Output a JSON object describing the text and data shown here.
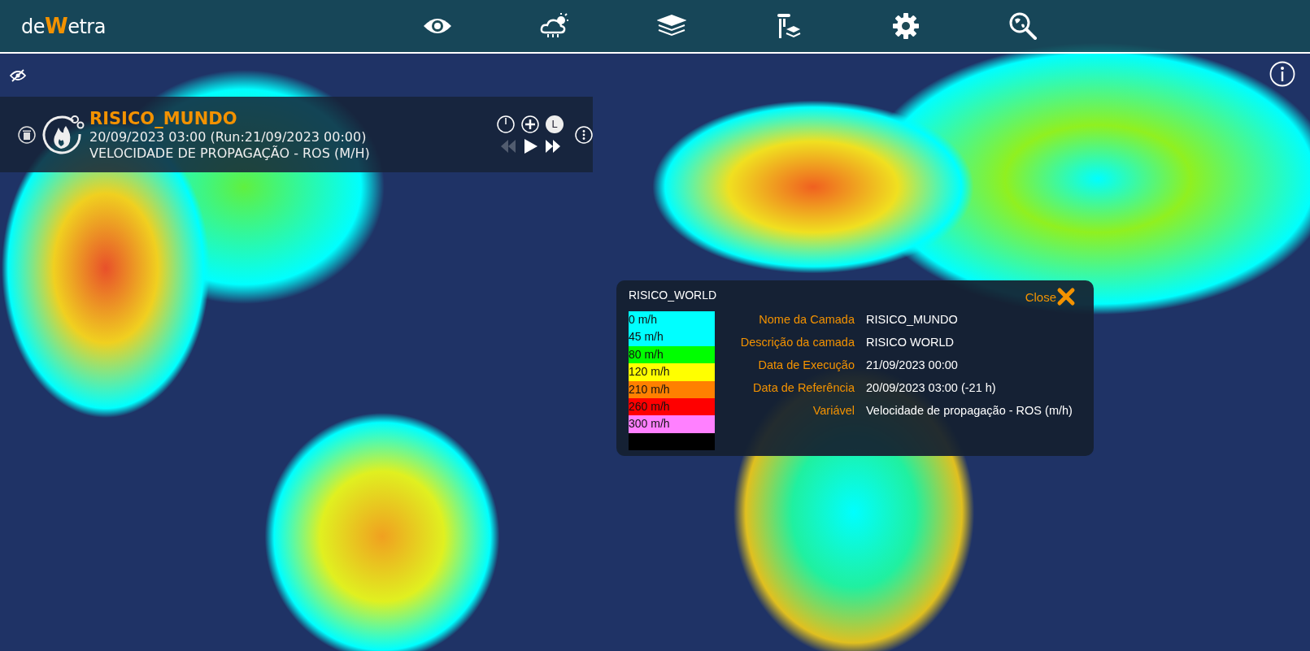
{
  "logo": {
    "before": "de",
    "mark": "W",
    "after": "etra"
  },
  "toolbar": [
    {
      "kind": "eye"
    },
    {
      "kind": "cloud"
    },
    {
      "kind": "layers"
    },
    {
      "kind": "column"
    },
    {
      "kind": "gear"
    },
    {
      "kind": "globe-search"
    }
  ],
  "layer": {
    "title": "RISICO_MUNDO",
    "date": "20/09/2023 03:00 (Run:21/09/2023 00:00)",
    "variable": "VELOCIDADE DE PROPAGAÇÃO - ROS (M/H)",
    "layer_letter": "L",
    "playback": [
      {
        "kind": "rewind",
        "disabled": true
      },
      {
        "kind": "play",
        "disabled": false
      },
      {
        "kind": "forward",
        "disabled": false
      }
    ]
  },
  "popup": {
    "title": "RISICO_WORLD",
    "close": "Close",
    "legend": [
      {
        "label": "0 m/h",
        "color": "#00ffff"
      },
      {
        "label": "45 m/h",
        "color": "#00ffff"
      },
      {
        "label": "80 m/h",
        "color": "#00ff00"
      },
      {
        "label": "120 m/h",
        "color": "#ffff00"
      },
      {
        "label": "210 m/h",
        "color": "#ff8000"
      },
      {
        "label": "260 m/h",
        "color": "#ff0000"
      },
      {
        "label": "300 m/h",
        "color": "#ff80ff"
      },
      {
        "color": "#000000"
      }
    ],
    "fields": [
      {
        "label": "Nome da Camada",
        "value": "RISICO_MUNDO"
      },
      {
        "label": "Descrição da camada",
        "value": "RISICO WORLD"
      },
      {
        "label": "Data de Execução",
        "value": "21/09/2023 00:00"
      },
      {
        "label": "Data de Referência",
        "value": "20/09/2023 03:00 (-21 h)"
      },
      {
        "label": "Variável",
        "value": "Velocidade de propagação - ROS (m/h)"
      }
    ]
  }
}
